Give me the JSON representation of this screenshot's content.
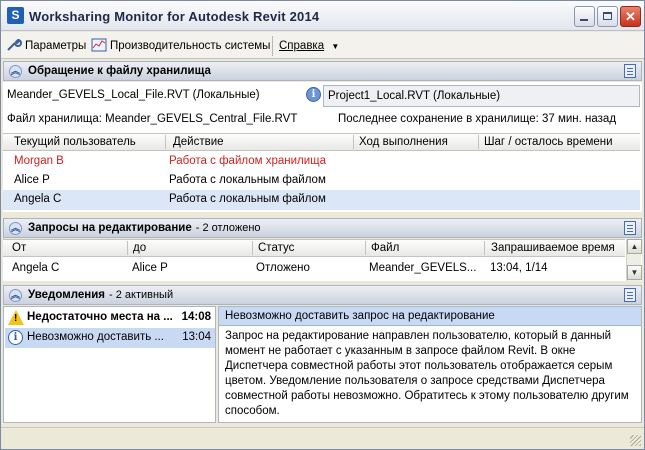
{
  "window": {
    "title": "Worksharing Monitor for Autodesk Revit 2014",
    "app_icon_letter": "S"
  },
  "menu": {
    "params": "Параметры",
    "perf": "Производительность системы",
    "help": "Справка"
  },
  "central": {
    "header": "Обращение к файлу хранилища",
    "local_file_tab": "Meander_GEVELS_Local_File.RVT (Локальные)",
    "project_tab": "Project1_Local.RVT (Локальные)",
    "storage_label": "Файл хранилища: Meander_GEVELS_Central_File.RVT",
    "last_save": "Последнее сохранение в хранилище:  37 мин. назад",
    "columns": [
      "Текущий пользователь",
      "Действие",
      "Ход выполнения",
      "Шаг / осталось времени"
    ],
    "rows": [
      {
        "user": "Morgan B",
        "action": "Работа с файлом хранилища",
        "progress": "",
        "step": ""
      },
      {
        "user": "Alice P",
        "action": "Работа с локальным файлом",
        "progress": "",
        "step": ""
      },
      {
        "user": "Angela C",
        "action": "Работа с локальным файлом",
        "progress": "",
        "step": ""
      }
    ],
    "highlight_color": "#d01f1f"
  },
  "requests": {
    "header": "Запросы на редактирование",
    "count": "- 2 отложено",
    "columns": [
      "От",
      "до",
      "Статус",
      "Файл",
      "Запрашиваемое время"
    ],
    "rows": [
      {
        "from": "Angela C",
        "to": "Alice P",
        "status": "Отложено",
        "file": "Meander_GEVELS...",
        "time": "13:04, 1/14"
      }
    ]
  },
  "notifications": {
    "header": "Уведомления",
    "count": "- 2 активный",
    "items": [
      {
        "label": "Недостаточно места на ...",
        "time": "14:08",
        "icon": "warning-icon"
      },
      {
        "label": "Невозможно доставить ...",
        "time": "13:04",
        "icon": "info-icon"
      }
    ],
    "detail_title": "Невозможно доставить запрос на редактирование",
    "detail_body": "Запрос на редактирование направлен пользователю, который в данный момент не работает с указанным в запросе файлом Revit. В окне Диспетчера совместной работы этот пользователь отображается серым цветом. Уведомление пользователя о запросе средствами Диспетчера совместной работы невозможно. Обратитесь к этому пользователю другим способом."
  }
}
